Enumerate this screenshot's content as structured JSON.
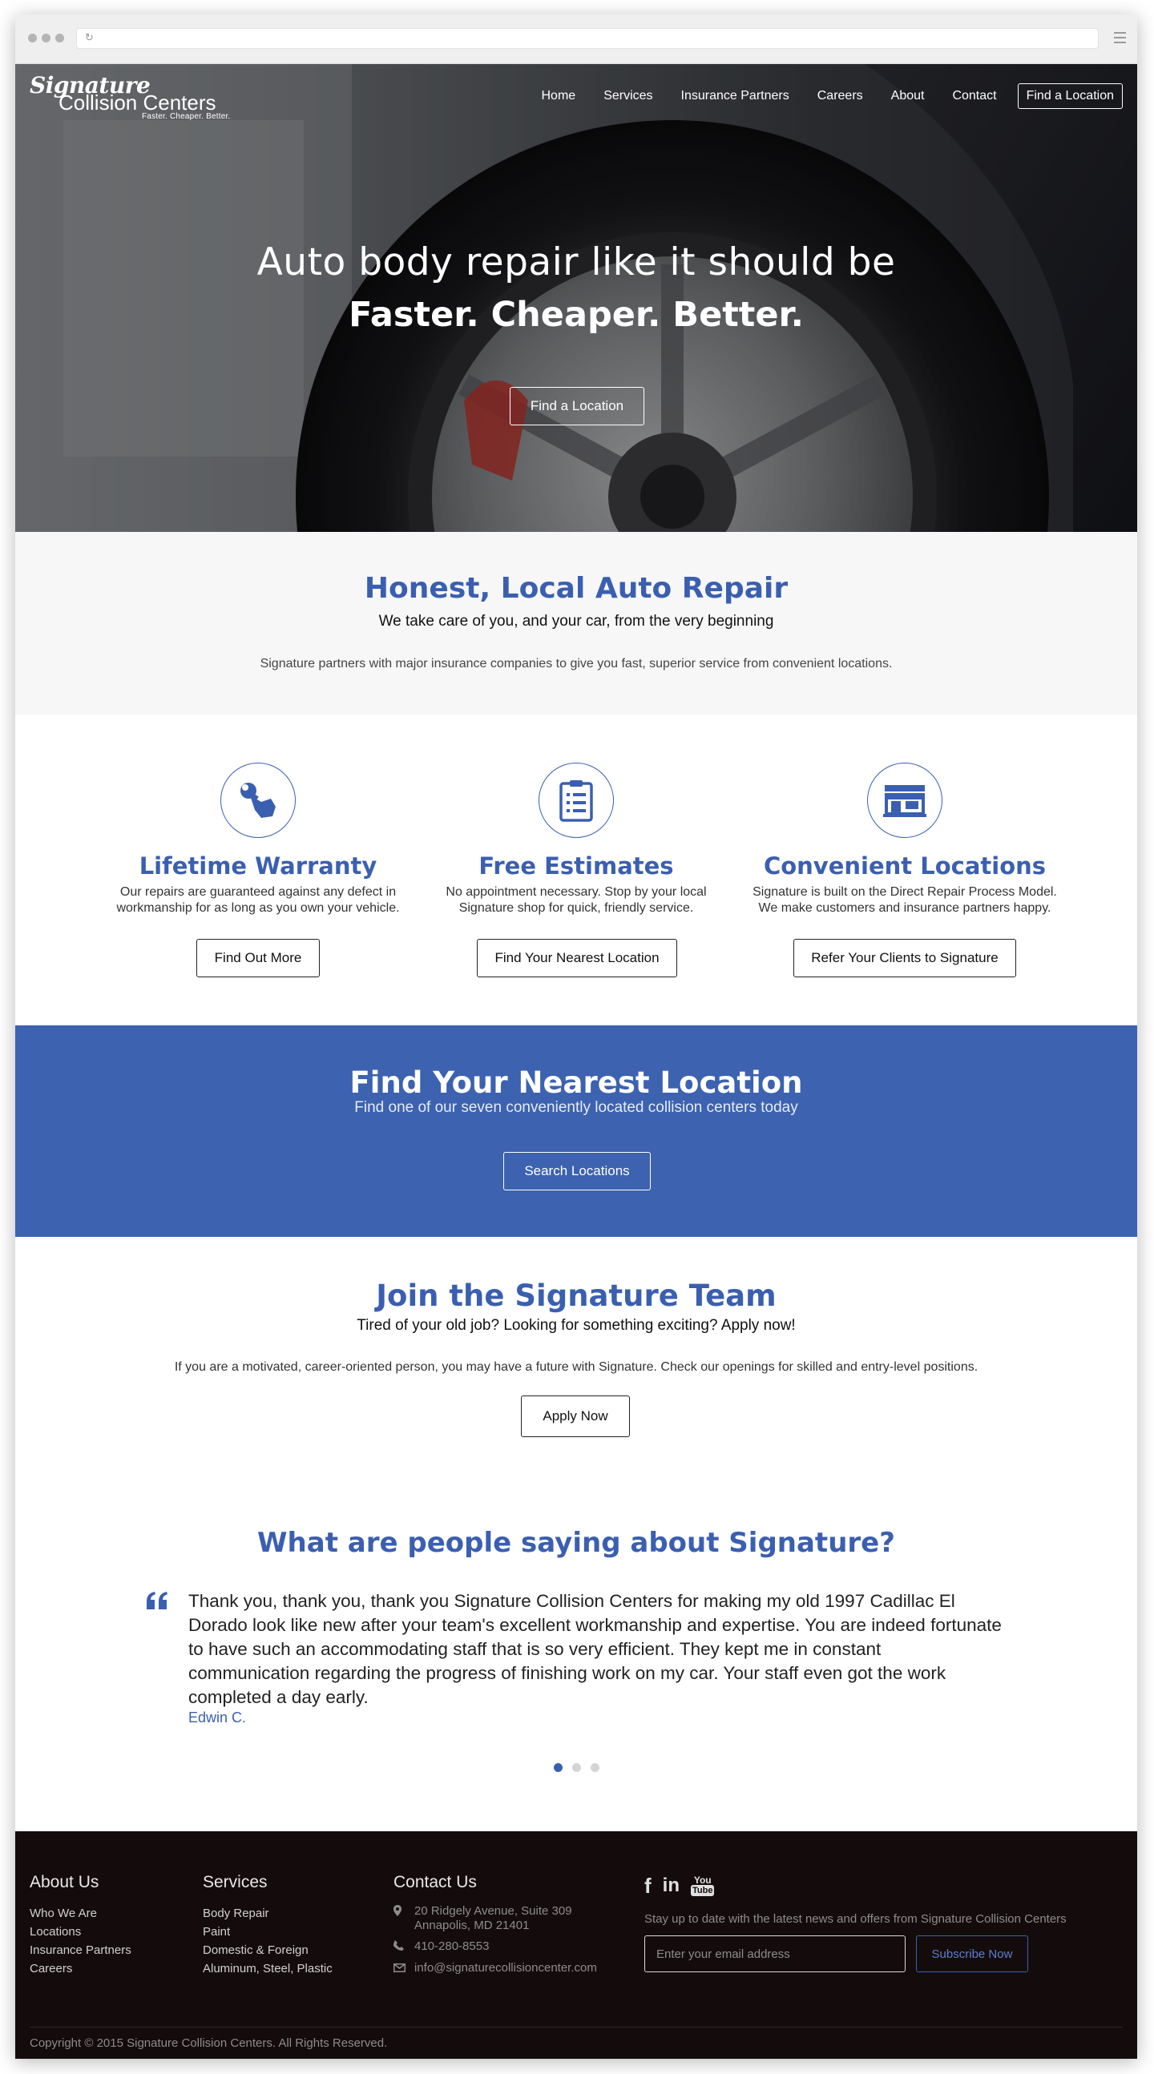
{
  "nav": {
    "items": [
      "Home",
      "Services",
      "Insurance Partners",
      "Careers",
      "About",
      "Contact"
    ],
    "cta": "Find a Location"
  },
  "logo": {
    "script": "Signature",
    "main": "Collision Centers",
    "tagline": "Faster. Cheaper. Better."
  },
  "hero": {
    "title_line1": "Auto body repair like it should be",
    "title_line2": "Faster. Cheaper. Better.",
    "button": "Find a Location"
  },
  "intro": {
    "title": "Honest, Local Auto Repair",
    "subtitle": "We take care of you, and your car, from the very beginning",
    "body": "Signature partners with major insurance companies to give you fast, superior service from convenient locations."
  },
  "features": [
    {
      "icon": "wrench-icon",
      "title": "Lifetime Warranty",
      "text_line1": "Our repairs are guaranteed against any defect in",
      "text_line2": "workmanship for as long as you own your vehicle.",
      "button": "Find Out More"
    },
    {
      "icon": "clipboard-icon",
      "title": "Free Estimates",
      "text_line1": "No appointment necessary. Stop by your local",
      "text_line2": "Signature shop for quick, friendly service.",
      "button": "Find Your Nearest Location"
    },
    {
      "icon": "storefront-icon",
      "title": "Convenient Locations",
      "text_line1": "Signature is built on the Direct Repair Process Model.",
      "text_line2": "We make customers and insurance partners happy.",
      "button": "Refer Your Clients to Signature"
    }
  ],
  "band": {
    "title": "Find Your Nearest Location",
    "subtitle": "Find one of our seven conveniently located collision centers today",
    "button": "Search Locations",
    "color": "#3c62b0"
  },
  "join": {
    "title": "Join the Signature Team",
    "subtitle": "Tired of your old job? Looking for something exciting? Apply now!",
    "body": "If you are a motivated, career-oriented person, you may have a future with Signature. Check our openings for skilled and entry-level positions.",
    "button": "Apply Now"
  },
  "testimonial": {
    "title": "What are people saying about Signature?",
    "quote": "Thank you, thank you, thank you Signature Collision Centers for making my old 1997 Cadillac El Dorado look like new after your team's excellent workmanship and expertise. You are indeed fortunate to have such an accommodating staff that is so very efficient. They kept me in constant communication regarding the progress of finishing work on my car. Your staff even got the work completed a day early.",
    "author": "Edwin C.",
    "active_slide": 1,
    "slide_count": 3
  },
  "footer": {
    "about": {
      "heading": "About Us",
      "links": [
        "Who We Are",
        "Locations",
        "Insurance Partners",
        "Careers"
      ]
    },
    "services": {
      "heading": "Services",
      "links": [
        "Body Repair",
        "Paint",
        "Domestic & Foreign",
        "Aluminum, Steel, Plastic"
      ]
    },
    "contact": {
      "heading": "Contact Us",
      "address_line1": "20 Ridgely Avenue, Suite 309",
      "address_line2": "Annapolis, MD 21401",
      "phone": "410-280-8553",
      "email": "info@signaturecollisioncenter.com"
    },
    "social": {
      "facebook": "f",
      "linkedin": "in",
      "youtube_top": "You",
      "youtube_bottom": "Tube"
    },
    "newsletter": {
      "text": "Stay up to date with the latest news and offers from Signature Collision Centers",
      "placeholder": "Enter your email address",
      "button": "Subscribe Now"
    },
    "copyright": "Copyright © 2015 Signature Collision Centers. All Rights Reserved."
  },
  "colors": {
    "accent": "#3b5fb0",
    "footer_bg": "#140c0c"
  }
}
